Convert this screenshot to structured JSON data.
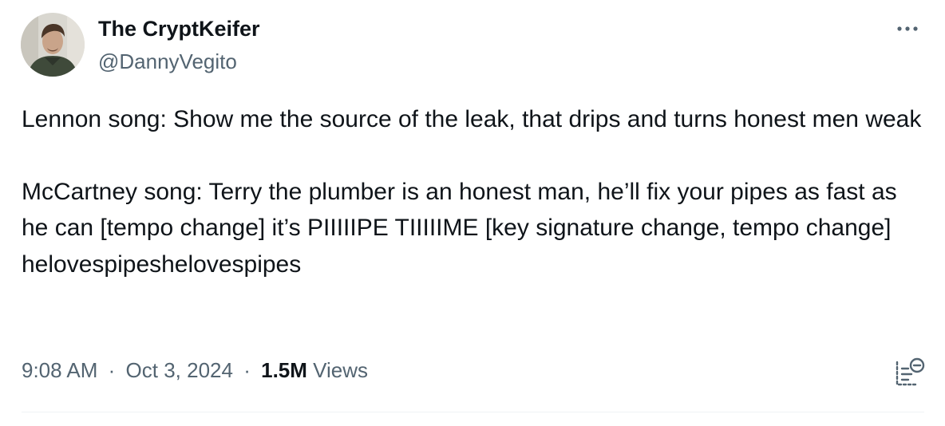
{
  "author": {
    "display_name": "The CryptKeifer",
    "handle": "@DannyVegito"
  },
  "tweet": {
    "paragraph_1": "Lennon song: Show me the source of the leak, that drips and turns honest men weak",
    "paragraph_2": "McCartney song: Terry the plumber is an honest man, he’ll fix your pipes as fast as he can [tempo change] it’s PIIIIIPE TIIIIIME [key signature change, tempo change] helovespipeshelovespipes"
  },
  "meta": {
    "time": "9:08 AM",
    "separator": "·",
    "date": "Oct 3, 2024",
    "views_count": "1.5M",
    "views_label": "Views"
  },
  "icons": {
    "more": "more-options-icon",
    "analytics": "analytics-icon"
  },
  "colors": {
    "text_primary": "#0f1419",
    "text_secondary": "#536471",
    "divider": "#eff3f4"
  }
}
